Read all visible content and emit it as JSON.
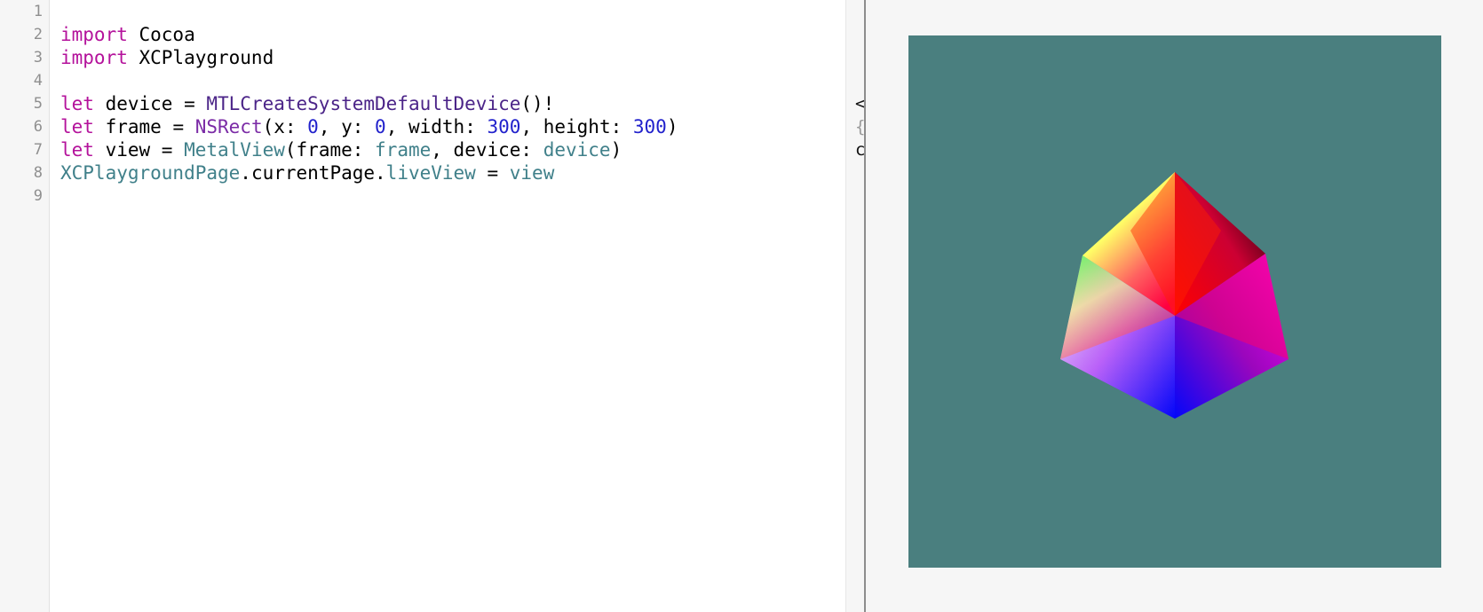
{
  "editor": {
    "line_numbers": [
      "1",
      "2",
      "3",
      "4",
      "5",
      "6",
      "7",
      "8",
      "9"
    ],
    "code": {
      "l2": {
        "kw": "import",
        "rest": " Cocoa"
      },
      "l3": {
        "kw": "import",
        "rest": " XCPlayground"
      },
      "l5": {
        "kw": "let",
        "a": " device = ",
        "fn": "MTLCreateSystemDefaultDevice",
        "b": "()!"
      },
      "l6": {
        "kw": "let",
        "a": " frame = ",
        "ty": "NSRect",
        "b": "(x: ",
        "n1": "0",
        "c": ", y: ",
        "n2": "0",
        "d": ", width: ",
        "n3": "300",
        "e": ", height: ",
        "n4": "300",
        "f": ")"
      },
      "l7": {
        "kw": "let",
        "a": " view = ",
        "ty": "MetalView",
        "b": "(frame: ",
        "p1": "frame",
        "c": ", device: ",
        "p2": "device",
        "d": ")"
      },
      "l8": {
        "p1": "XCPlaygroundPage",
        "a": ".currentPage.",
        "p2": "liveView",
        "b": " = ",
        "p3": "view"
      }
    }
  },
  "results": {
    "fragments": [
      "<",
      "{",
      "c"
    ]
  },
  "live_view": {
    "background": "#4a7f7f",
    "content": "rgb-color-cube"
  },
  "colors": {
    "keyword": "#b4129b",
    "function": "#4b2488",
    "type": "#7b2ba6",
    "number": "#2222cc",
    "project_identifier": "#40808a"
  }
}
